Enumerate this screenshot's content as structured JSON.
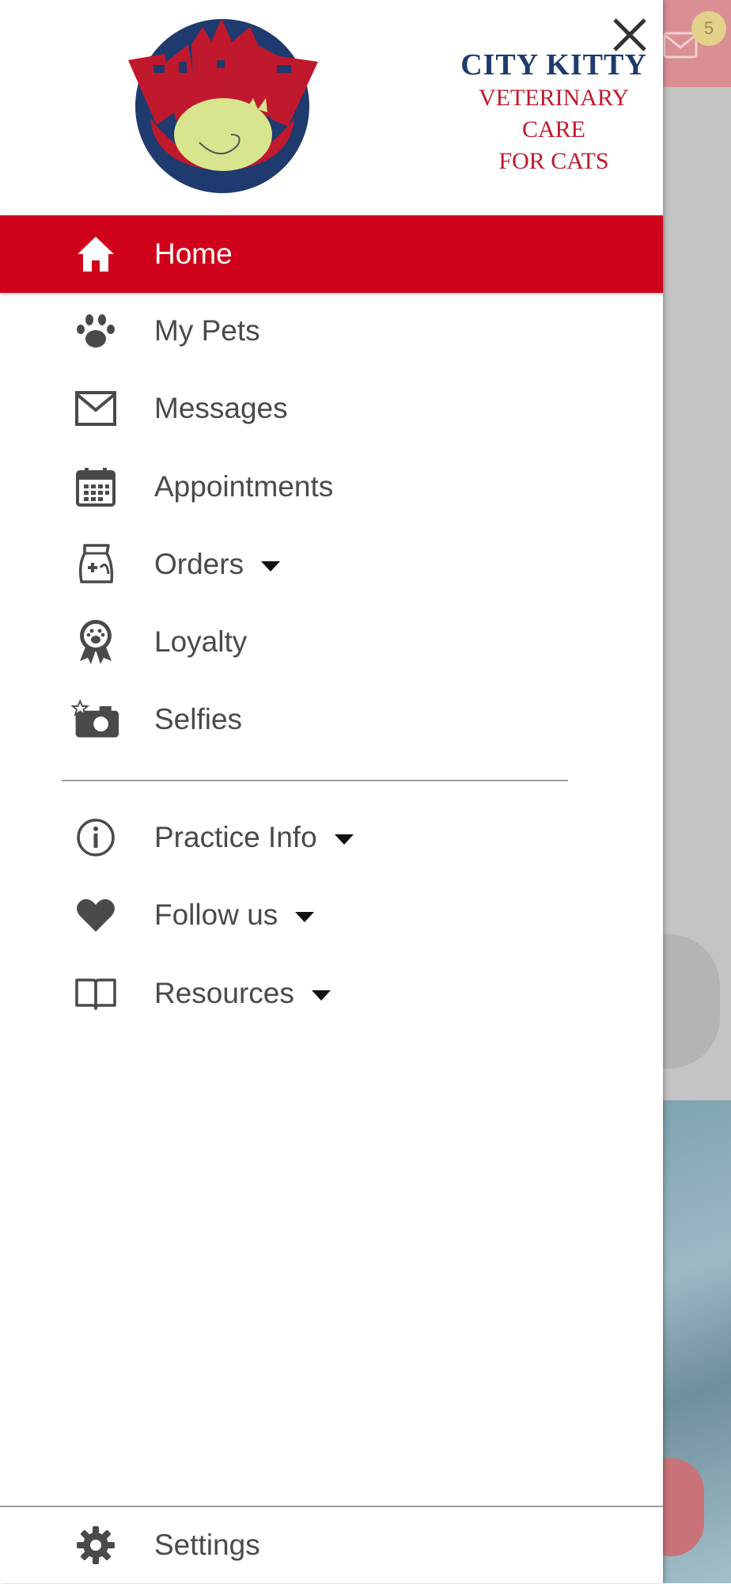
{
  "background": {
    "badge_count": "5"
  },
  "logo": {
    "title": "CITY KITTY",
    "line1": "VETERINARY",
    "line2": "CARE",
    "line3": "FOR CATS"
  },
  "menu": {
    "items": [
      {
        "label": "Home",
        "icon": "home-icon",
        "active": true
      },
      {
        "label": "My Pets",
        "icon": "paw-icon"
      },
      {
        "label": "Messages",
        "icon": "envelope-icon"
      },
      {
        "label": "Appointments",
        "icon": "calendar-icon"
      },
      {
        "label": "Orders",
        "icon": "food-bag-icon",
        "expandable": true
      },
      {
        "label": "Loyalty",
        "icon": "award-ribbon-icon"
      },
      {
        "label": "Selfies",
        "icon": "camera-star-icon"
      }
    ],
    "secondary": [
      {
        "label": "Practice Info",
        "icon": "info-icon",
        "expandable": true
      },
      {
        "label": "Follow us",
        "icon": "heart-icon",
        "expandable": true
      },
      {
        "label": "Resources",
        "icon": "open-book-icon",
        "expandable": true
      }
    ],
    "settings": {
      "label": "Settings",
      "icon": "gear-icon"
    }
  },
  "colors": {
    "active_bg": "#d0021b",
    "logo_navy": "#1e3a6e",
    "logo_red": "#c0192d",
    "icon_gray": "#4a4a4a"
  }
}
